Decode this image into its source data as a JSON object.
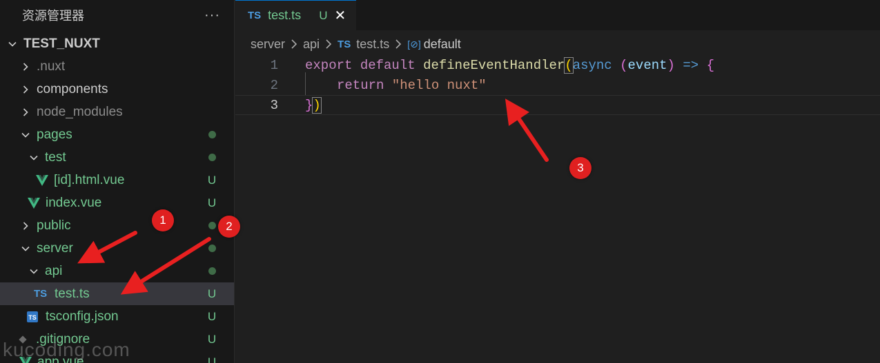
{
  "explorer": {
    "title": "资源管理器",
    "more": "···",
    "project": "TEST_NUXT",
    "items": [
      {
        "label": ".nuxt",
        "status": ""
      },
      {
        "label": "components",
        "status": ""
      },
      {
        "label": "node_modules",
        "status": ""
      },
      {
        "label": "pages",
        "status": "dot"
      },
      {
        "label": "test",
        "status": "dot"
      },
      {
        "label": "[id].html.vue",
        "status": "U"
      },
      {
        "label": "index.vue",
        "status": "U"
      },
      {
        "label": "public",
        "status": "dot"
      },
      {
        "label": "server",
        "status": "dot"
      },
      {
        "label": "api",
        "status": "dot"
      },
      {
        "label": "test.ts",
        "status": "U"
      },
      {
        "label": "tsconfig.json",
        "status": "U"
      },
      {
        "label": ".gitignore",
        "status": "U"
      },
      {
        "label": "app.vue",
        "status": "U"
      }
    ]
  },
  "tab": {
    "icon": "TS",
    "label": "test.ts",
    "modified": "U",
    "close": "✕"
  },
  "breadcrumb": {
    "p1": "server",
    "p2": "api",
    "p3_icon": "TS",
    "p3": "test.ts",
    "p4_icon": "[⊘]",
    "p4": "default"
  },
  "code": {
    "line_numbers": [
      "1",
      "2",
      "3"
    ],
    "l1": {
      "kw": "export",
      "kw2": "default",
      "fn": "defineEventHandler",
      "p1": "(",
      "async": "async",
      "pa": "(",
      "param": "event",
      "pb": ")",
      "arrow": "=>",
      "brace": "{"
    },
    "l2": {
      "kw": "return",
      "str": "\"hello nuxt\""
    },
    "l3": {
      "brace": "}",
      "p": ")"
    }
  },
  "annotations": {
    "b1": "1",
    "b2": "2",
    "b3": "3",
    "color": "#e02020"
  },
  "watermark": "kucoding.com"
}
